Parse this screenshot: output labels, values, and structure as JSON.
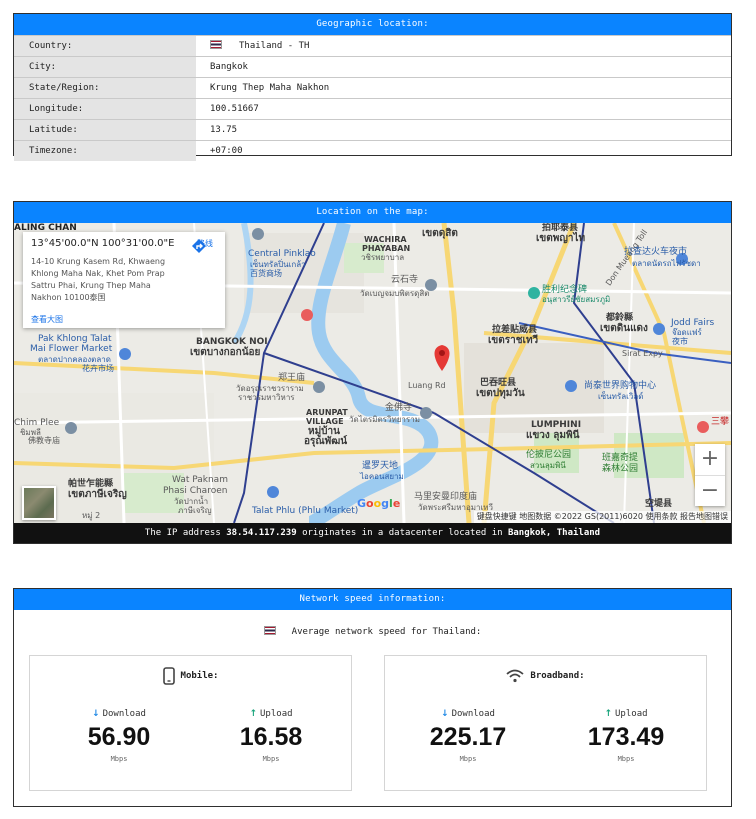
{
  "geo": {
    "header": "Geographic location:",
    "rows": [
      {
        "key": "Country:",
        "value": "Thailand - TH"
      },
      {
        "key": "City:",
        "value": "Bangkok"
      },
      {
        "key": "State/Region:",
        "value": "Krung Thep Maha Nakhon"
      },
      {
        "key": "Longitude:",
        "value": "100.51667"
      },
      {
        "key": "Latitude:",
        "value": "13.75"
      },
      {
        "key": "Timezone:",
        "value": "+07:00"
      }
    ]
  },
  "map": {
    "header": "Location on the map:",
    "card": {
      "coords": "13°45'00.0\"N 100°31'00.0\"E",
      "address": "14-10 Krung Kasem Rd, Khwaeng Khlong Maha Nak, Khet Pom Prap Sattru Phai, Krung Thep Maha Nakhon 10100泰国",
      "directions": "路线",
      "larger_map": "查看大图"
    },
    "labels": {
      "taling_chan": "ALING CHAN",
      "central_pinklao": "Central Pinklao",
      "central_pinklao_th": "เซ็นทรัลปิ่นเกล้า",
      "central_pinklao_zh": "百货商场",
      "wachira": "WACHIRA",
      "phayaban": "PHAYABAN",
      "wachira_th": "วชิรพยาบาล",
      "dusit_th": "เขตดุสิต",
      "chatuchak_zh": "拍耶泰县",
      "phaya_thai_th": "เขตพญาไท",
      "yunshi_zh": "云石寺",
      "yunshi_th": "วัดเบญจมบพิตรดุสิต",
      "victory_zh": "胜利纪念碑",
      "victory_th": "อนุสาวรีย์ชัยสมรภูมิ",
      "don_mueang": "Don Mueang Toll",
      "ratchada_zh": "拉查达火车夜市",
      "ratchada_th": "ตลาดนัดรถไฟรัชดา",
      "ratchathewi_zh": "拉差贴威县",
      "ratchathewi_th": "เขตราชเทวี",
      "makkasan_zh": "都鈴縣",
      "din_daeng_th": "เขตดินแดง",
      "jodd_fairs": "Jodd Fairs",
      "jodd_fairs_th": "จ๊อดแฟร์",
      "jodd_fairs_zh": "夜市",
      "sirat_expy": "Sirat Expy",
      "pak_khlong": "Pak Khlong Talat",
      "mai_flower": "Mai Flower Market",
      "pak_khlong_th": "ตลาดปากคลองตลาด",
      "pak_khlong_zh": "花卉市场",
      "bangkok_noi": "BANGKOK NOI",
      "bangkok_noi_th": "เขตบางกอกน้อย",
      "zhengwang_zh": "郑王庙",
      "wat_arun_th": "วัดอรุณราชวราราม",
      "wat_arun_th2": "ราชวรมหาวิหาร",
      "luang_rd": "Luang Rd",
      "pathum_wan_zh": "巴吞旺县",
      "pathum_wan_th": "เขตปทุมวัน",
      "central_world_zh": "尚泰世界购物中心",
      "central_world_th": "เซ็นทรัลเวิลด์",
      "lumphini": "LUMPHINI",
      "lumphini_th": "แขวง ลุมพินี",
      "lumphini_park_zh": "伦披尼公园",
      "lumphini_park_th": "สวนลุมพินี",
      "benjakitti_zh": "班嘉奇提",
      "benjakitti_zh2": "森林公园",
      "sam_yan_zh": "三攀",
      "golden_mount_zh": "金佛寺",
      "golden_mount_th": "วัดไตรมิตรวิทยาราม",
      "arunpat": "ARUNPAT",
      "village": "VILLAGE",
      "village_th": "หมู่บ้าน",
      "village_th2": "อรุณพัฒน์",
      "chim_plee": "Chim Plee",
      "chim_plee_th": "ชิมพลี",
      "chim_plee_zh": "佛教寺庙",
      "wat_paknam": "Wat Paknam",
      "phasi_charoen": "Phasi Charoen",
      "wat_paknam_th": "วัดปากน้ำ",
      "wat_paknam_zh": "ภาษีเจริญ",
      "phasi_charoen_zh": "帕世乍能縣",
      "phasi_charoen_th": "เขตภาษีเจริญ",
      "chinatown_zh": "暹罗天地",
      "iconsiam_th": "ไอคอนสยาม",
      "little_india_zh": "马里安曼印度庙",
      "little_india_th": "วัดพระศรีมหาอุมาเทวี",
      "talat_phlu": "Talat Phlu (Phlu Market)",
      "khong_toei_zh": "空堤县",
      "khong_toei_th": "เขตคลองเตย",
      "bang_sue_zh": "八吞县",
      "moo2": "หมู่ 2"
    },
    "attribution": "键盘快捷键  地图数据 ©2022 GS(2011)6020  使用条款  报告地图错误",
    "zoom_in": "+",
    "zoom_out": "−",
    "ip_prefix": "The IP address",
    "ip": "38.54.117.239",
    "ip_middle": "originates in a datacenter located in",
    "ip_location": "Bangkok, Thailand"
  },
  "speed": {
    "header": "Network speed information:",
    "average_label": "Average network speed for Thailand:",
    "mobile": {
      "title": "Mobile:",
      "download_label": "Download",
      "download": "56.90",
      "upload_label": "Upload",
      "upload": "16.58",
      "unit": "Mbps"
    },
    "broadband": {
      "title": "Broadband:",
      "download_label": "Download",
      "download": "225.17",
      "upload_label": "Upload",
      "upload": "173.49",
      "unit": "Mbps"
    }
  },
  "colors": {
    "header_blue": "#0a84ff",
    "download_arrow": "#1e88e5",
    "upload_arrow": "#16a37a",
    "pin_red": "#e53935"
  }
}
